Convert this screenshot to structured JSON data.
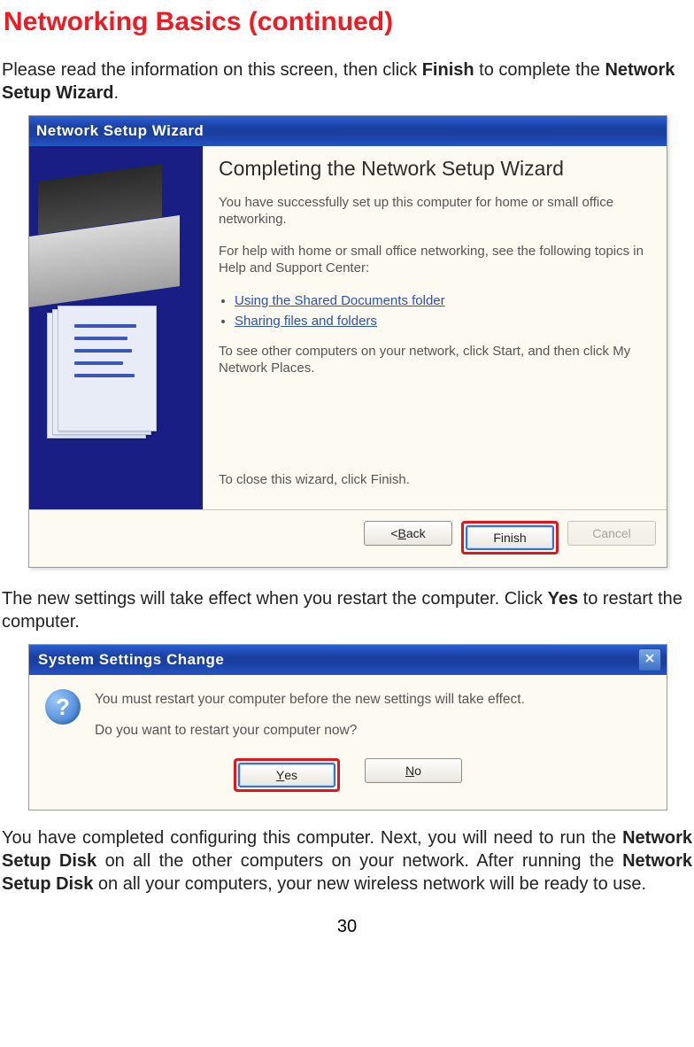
{
  "page": {
    "title": "Networking Basics (continued)",
    "intro_before": "Please read the information on this screen, then click ",
    "intro_bold1": "Finish",
    "intro_mid": " to complete the ",
    "intro_bold2": "Network Setup Wizard",
    "intro_after": ".",
    "para2_before": "The new settings will take effect when you restart the computer. Click ",
    "para2_bold": "Yes",
    "para2_after": " to restart the computer.",
    "para3_a": "You have completed configuring this computer. Next, you will need to run the ",
    "para3_b1": "Network Setup Disk",
    "para3_b": " on all the other computers on your network. After running the ",
    "para3_b2": "Network Setup Disk",
    "para3_c": " on all your computers, your new wireless network will be ready to use.",
    "page_number": "30"
  },
  "wizard": {
    "title": "Network Setup Wizard",
    "heading": "Completing the Network Setup Wizard",
    "p1": "You have successfully set up this computer for home or small office networking.",
    "p2": "For help with home or small office networking, see the following topics in Help and Support Center:",
    "link1": "Using the Shared Documents folder",
    "link2": "Sharing files and folders",
    "p3": "To see other computers on your network, click Start, and then click My Network Places.",
    "p4": "To close this wizard, click Finish.",
    "buttons": {
      "back_prefix": "< ",
      "back_u": "B",
      "back_rest": "ack",
      "finish": "Finish",
      "cancel": "Cancel"
    }
  },
  "dialog": {
    "title": "System Settings Change",
    "line1": "You must restart your computer before the new settings will take effect.",
    "line2": "Do you want to restart your computer now?",
    "yes_u": "Y",
    "yes_rest": "es",
    "no_u": "N",
    "no_rest": "o"
  }
}
